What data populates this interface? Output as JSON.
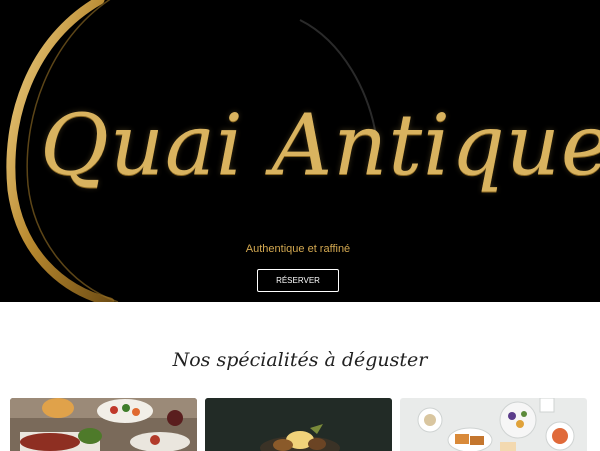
{
  "hero": {
    "brand": "Quai Antique",
    "tagline": "Authentique et raffiné",
    "reserve_label": "RÉSERVER"
  },
  "specialties": {
    "title": "Nos spécialités à déguster",
    "cards": [
      {
        "name": "dish-photo-meat-platter"
      },
      {
        "name": "dish-photo-dark-plate"
      },
      {
        "name": "dish-photo-brunch-table"
      }
    ]
  },
  "colors": {
    "hero_background": "#000000",
    "gold": "#d9b35f",
    "button_border": "#ffffff"
  }
}
